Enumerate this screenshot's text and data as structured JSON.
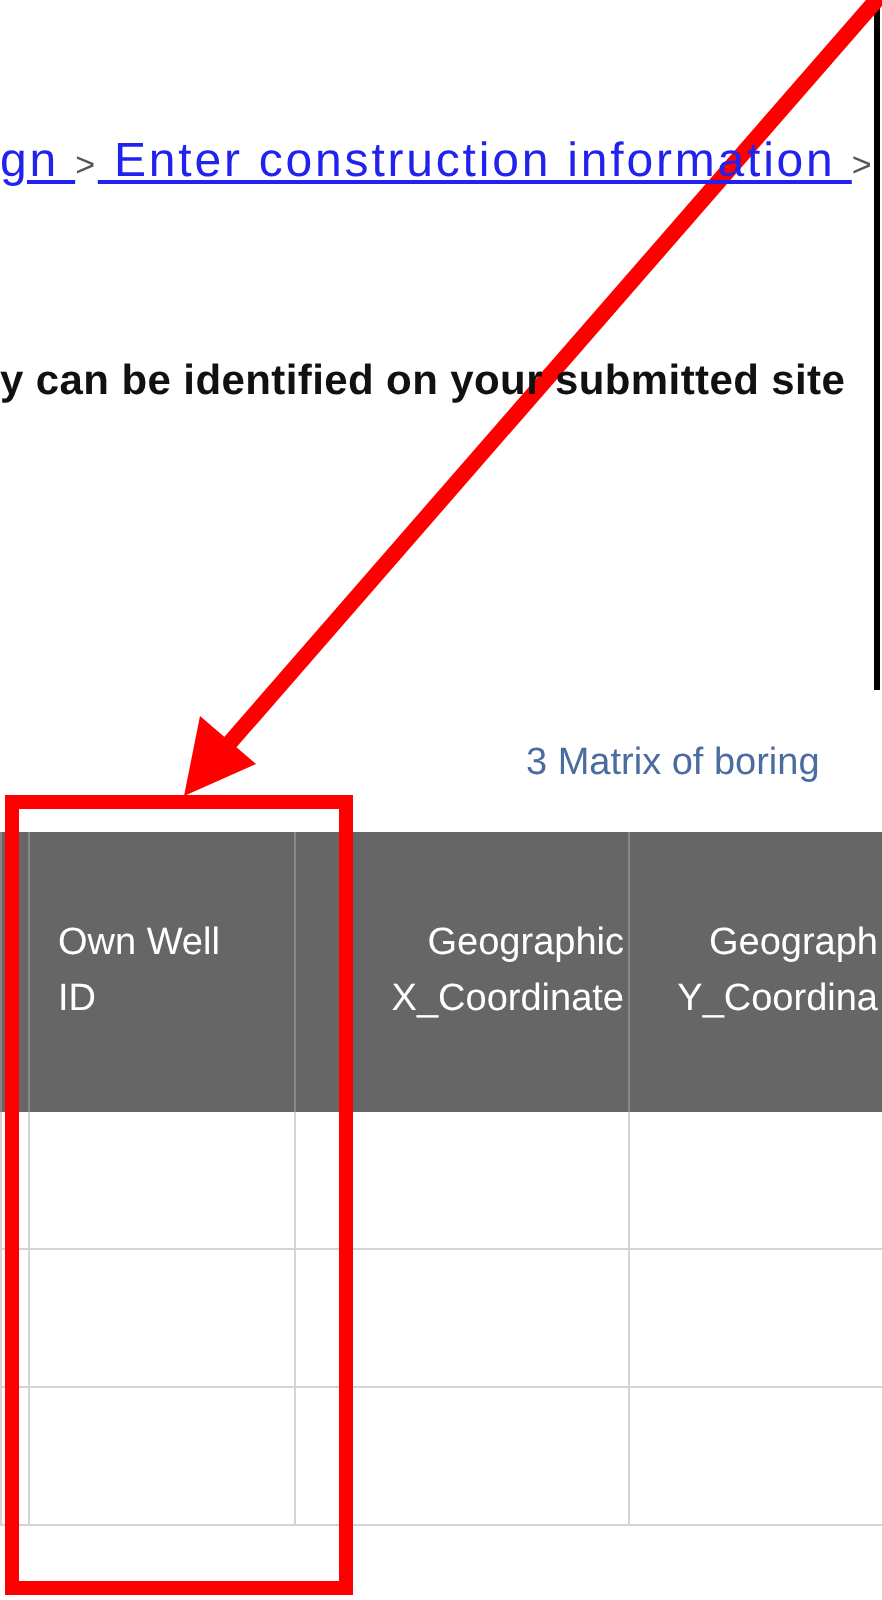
{
  "breadcrumb": [
    {
      "kind": "link",
      "text": "gn "
    },
    {
      "kind": "separator",
      "text": ">"
    },
    {
      "kind": "link",
      "text": " Enter construction information "
    },
    {
      "kind": "separator",
      "text": ">"
    }
  ],
  "instruction": "y can be identified on your submitted site",
  "table": {
    "caption": "3 Matrix of boring",
    "columns": [
      {
        "label": "Own Well ID"
      },
      {
        "label": "Geographic X_Coordinate"
      },
      {
        "label": "Geograph Y_Coordina"
      }
    ],
    "rows": [
      {
        "kind": "empty"
      },
      {
        "kind": "empty"
      },
      {
        "kind": "empty"
      }
    ]
  },
  "annotation": {
    "arrow": true,
    "highlight_box": true
  }
}
